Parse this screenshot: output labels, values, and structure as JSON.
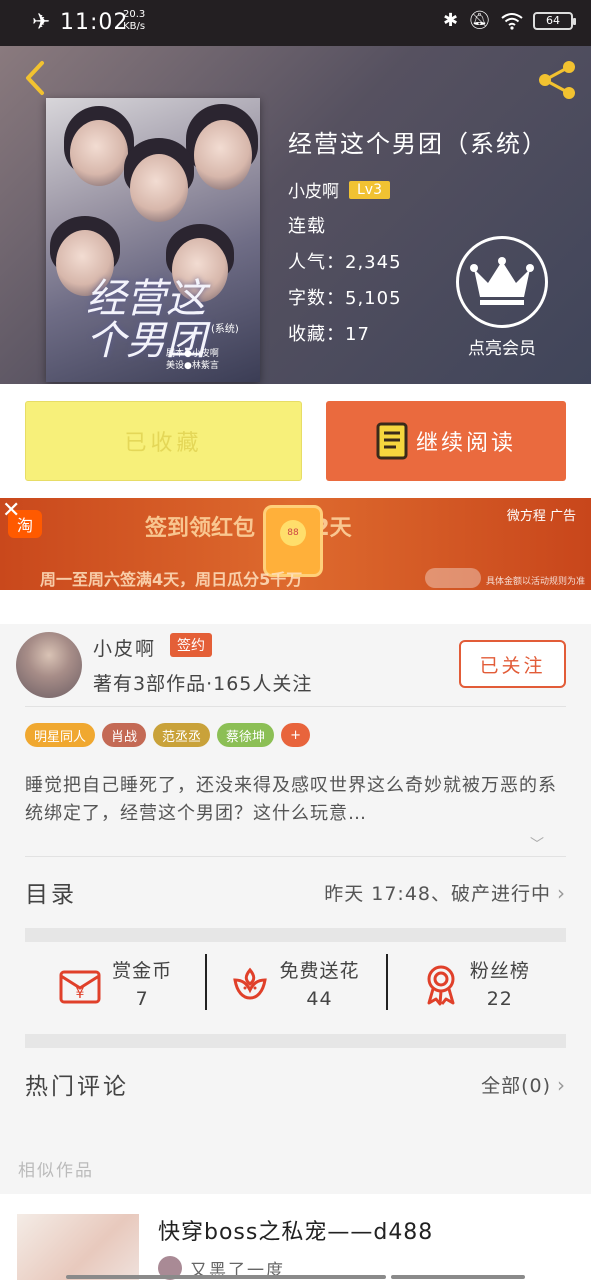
{
  "status_bar": {
    "time": "11:02",
    "speed_value": "20.3",
    "speed_unit": "KB/s",
    "battery": "64"
  },
  "book": {
    "title": "经营这个男团（系统）",
    "author": "小皮啊",
    "level": "Lv3",
    "status": "连载",
    "popularity": "人气：2,345",
    "words": "字数：5,105",
    "favorites": "收藏：17",
    "cover_title": "经营这个男团",
    "cover_subtitle": "(系统)",
    "cover_credit_1": "剧本●小皮啊",
    "cover_credit_2": "美设●林紫言"
  },
  "vip": {
    "label": "点亮会员"
  },
  "actions": {
    "favorited_label": "已收藏",
    "read_label": "继续阅读"
  },
  "ad": {
    "line1": "签到领红包 已签 2天",
    "line2": "周一至周六签满4天，周日瓜分5千万",
    "tag": "微方程 广告",
    "note": "具体金额以活动规则为准",
    "coupon_value": "88"
  },
  "author_section": {
    "name": "小皮啊",
    "badge": "签约",
    "works": "著有3部作品·165人关注",
    "follow_label": "已关注",
    "tags": [
      {
        "label": "明星同人",
        "color": "#f0a830"
      },
      {
        "label": "肖战",
        "color": "#c46a55"
      },
      {
        "label": "范丞丞",
        "color": "#c9a23a"
      },
      {
        "label": "蔡徐坤",
        "color": "#8cbf55"
      },
      {
        "label": "+",
        "color": "#e8643c"
      }
    ],
    "description": "睡觉把自己睡死了，还没来得及感叹世界这么奇妙就被万恶的系统绑定了，经营这个男团？这什么玩意…"
  },
  "catalog": {
    "label": "目录",
    "latest": "昨天 17:48、破产进行中"
  },
  "stats": [
    {
      "label": "赏金币",
      "value": "7",
      "icon": "coin-envelope-icon"
    },
    {
      "label": "免费送花",
      "value": "44",
      "icon": "flower-icon"
    },
    {
      "label": "粉丝榜",
      "value": "22",
      "icon": "ribbon-icon"
    }
  ],
  "comments": {
    "label": "热门评论",
    "all": "全部(0)"
  },
  "similar": {
    "header": "相似作品",
    "item_title": "快穿boss之私宠——d488",
    "item_author": "又黑了一度"
  },
  "colors": {
    "accent": "#ea6a3e",
    "fav_yellow": "#f7f07a"
  }
}
